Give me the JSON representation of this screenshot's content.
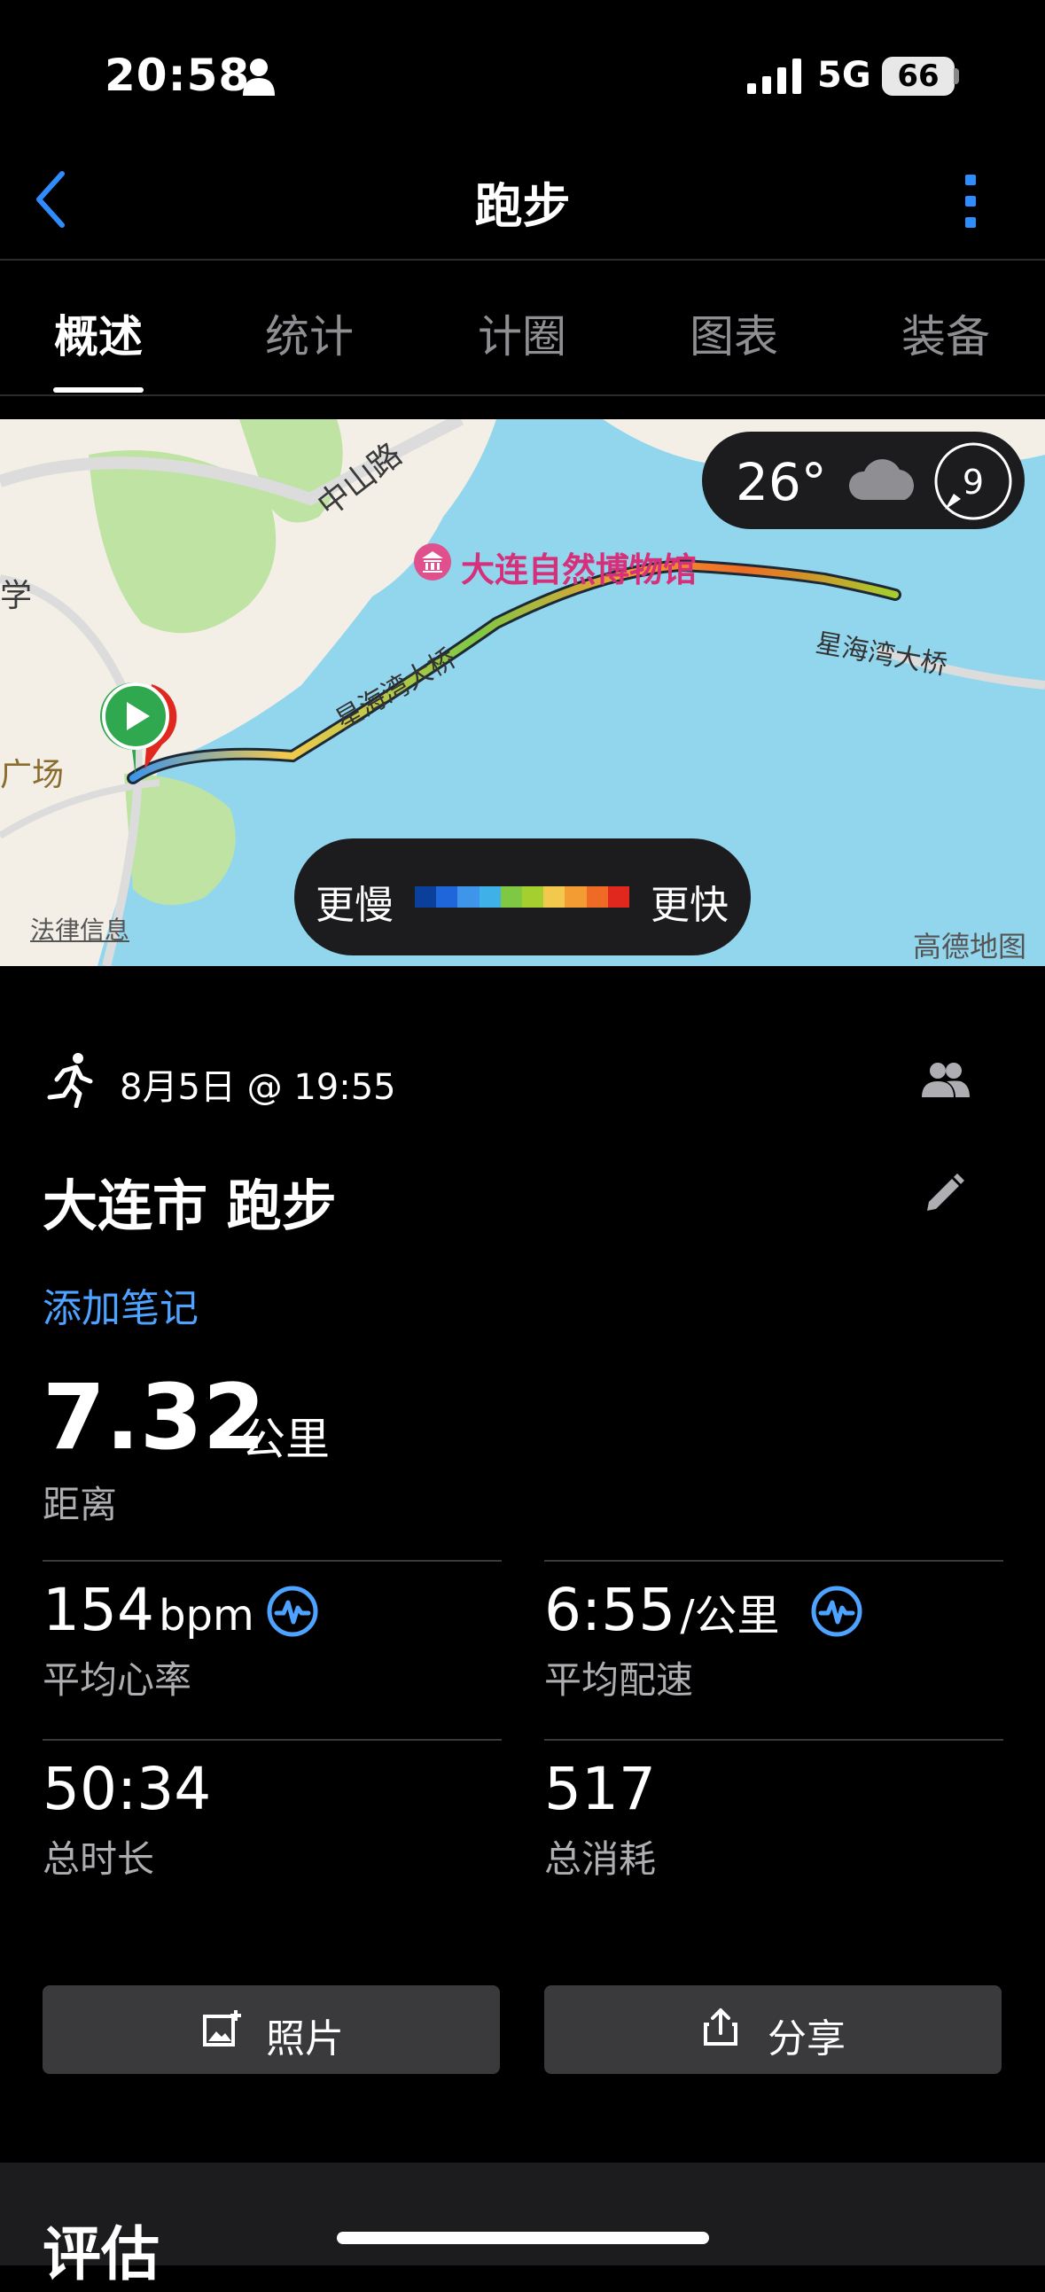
{
  "status_bar": {
    "time": "20:58",
    "network": "5G",
    "battery": "66"
  },
  "nav": {
    "title": "跑步"
  },
  "tabs": [
    {
      "label": "概述",
      "active": true
    },
    {
      "label": "统计",
      "active": false
    },
    {
      "label": "计圈",
      "active": false
    },
    {
      "label": "图表",
      "active": false
    },
    {
      "label": "装备",
      "active": false
    }
  ],
  "map": {
    "labels": {
      "zhongshan_road": "中山路",
      "museum": "大连自然博物馆",
      "bridge_1": "星海湾大桥",
      "bridge_2": "星海湾大桥",
      "plaza": "广场",
      "xue": "学",
      "legal": "法律信息",
      "amap": "高德地图"
    },
    "weather": {
      "temp": "26°",
      "wind": "9",
      "icon": "cloud-icon"
    },
    "legend": {
      "slow": "更慢",
      "fast": "更快",
      "colors": [
        "#0a3f9c",
        "#1e66d9",
        "#3f95ea",
        "#3fb0e8",
        "#7fc843",
        "#a5cf2e",
        "#f2c94c",
        "#f39c33",
        "#ef6b25",
        "#e0281e"
      ]
    }
  },
  "activity": {
    "date": "8月5日 @ 19:55",
    "title": "大连市 跑步",
    "add_note": "添加笔记",
    "distance": {
      "value": "7.32",
      "unit": "公里",
      "label": "距离"
    },
    "stats": [
      {
        "value": "154",
        "unit": "bpm",
        "label": "平均心率",
        "icon": "heart-rate-icon"
      },
      {
        "value": "6:55",
        "unit": "/公里",
        "label": "平均配速",
        "icon": "heart-rate-icon"
      },
      {
        "value": "50:34",
        "unit": "",
        "label": "总时长"
      },
      {
        "value": "517",
        "unit": "",
        "label": "总消耗"
      }
    ]
  },
  "buttons": {
    "photo": "照片",
    "share": "分享"
  },
  "evaluation": {
    "title": "评估"
  },
  "colors": {
    "accent": "#4da3ff",
    "card": "#3a3a3c"
  }
}
